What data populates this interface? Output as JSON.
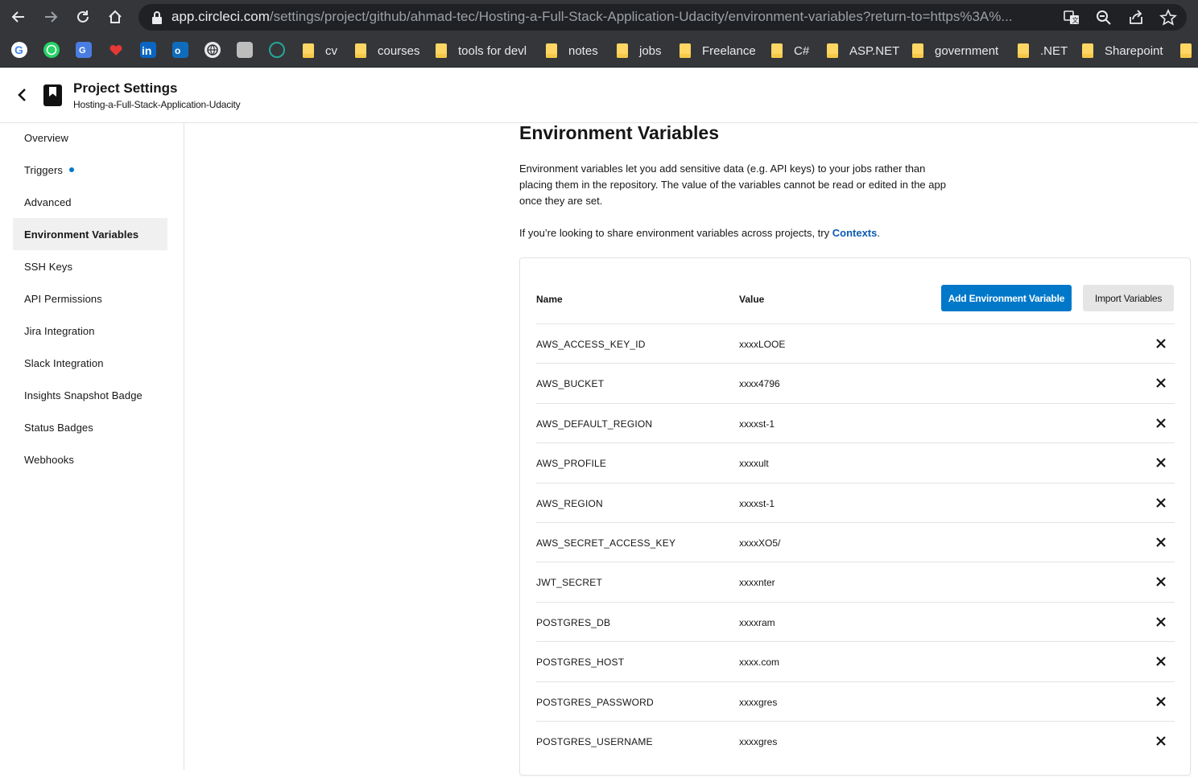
{
  "browser": {
    "url_host": "app.circleci.com",
    "url_path": "/settings/project/github/ahmad-tec/Hosting-a-Full-Stack-Application-Udacity/environment-variables?return-to=https%3A%...",
    "bookmarks": [
      "cv",
      "courses",
      "tools for devl",
      "notes",
      "jobs",
      "Freelance",
      "C#",
      "ASP.NET",
      "government",
      ".NET",
      "Sharepoint"
    ]
  },
  "header": {
    "title": "Project Settings",
    "subtitle": "Hosting-a-Full-Stack-Application-Udacity"
  },
  "sidebar": {
    "items": [
      {
        "label": "Overview"
      },
      {
        "label": "Triggers"
      },
      {
        "label": "Advanced"
      },
      {
        "label": "Environment Variables"
      },
      {
        "label": "SSH Keys"
      },
      {
        "label": "API Permissions"
      },
      {
        "label": "Jira Integration"
      },
      {
        "label": "Slack Integration"
      },
      {
        "label": "Insights Snapshot Badge"
      },
      {
        "label": "Status Badges"
      },
      {
        "label": "Webhooks"
      }
    ],
    "active": "Environment Variables"
  },
  "main": {
    "title": "Environment Variables",
    "description": "Environment variables let you add sensitive data (e.g. API keys) to your jobs rather than placing them in the repository. The value of the variables cannot be read or edited in the app once they are set.",
    "share_text": "If you’re looking to share environment variables across projects, try ",
    "share_link": "Contexts",
    "share_end": ".",
    "table": {
      "name_header": "Name",
      "value_header": "Value",
      "add_button": "Add Environment Variable",
      "import_button": "Import Variables",
      "rows": [
        {
          "name": "AWS_ACCESS_KEY_ID",
          "value": "xxxxLOOE"
        },
        {
          "name": "AWS_BUCKET",
          "value": "xxxx4796"
        },
        {
          "name": "AWS_DEFAULT_REGION",
          "value": "xxxxst-1"
        },
        {
          "name": "AWS_PROFILE",
          "value": "xxxxult"
        },
        {
          "name": "AWS_REGION",
          "value": "xxxxst-1"
        },
        {
          "name": "AWS_SECRET_ACCESS_KEY",
          "value": "xxxxXO5/"
        },
        {
          "name": "JWT_SECRET",
          "value": "xxxxnter"
        },
        {
          "name": "POSTGRES_DB",
          "value": "xxxxram"
        },
        {
          "name": "POSTGRES_HOST",
          "value": "xxxx.com"
        },
        {
          "name": "POSTGRES_PASSWORD",
          "value": "xxxxgres"
        },
        {
          "name": "POSTGRES_USERNAME",
          "value": "xxxxgres"
        }
      ]
    }
  }
}
